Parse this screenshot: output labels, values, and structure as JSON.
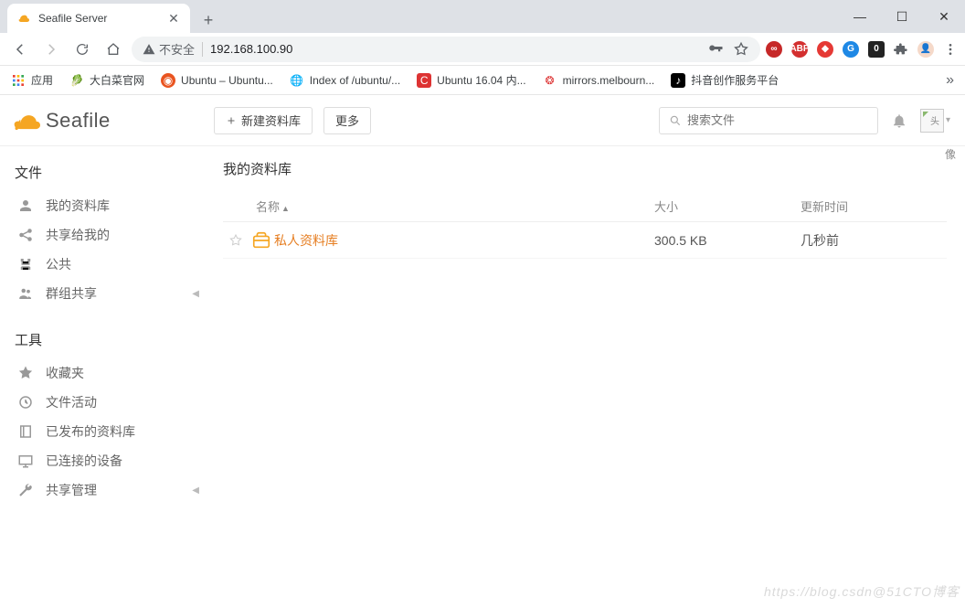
{
  "browser": {
    "tab_title": "Seafile Server",
    "url_warning": "不安全",
    "url": "192.168.100.90",
    "window_controls": {
      "min": "—",
      "max": "☐",
      "close": "✕"
    }
  },
  "bookmarks": {
    "apps_label": "应用",
    "items": [
      {
        "label": "大白菜官网"
      },
      {
        "label": "Ubuntu – Ubuntu..."
      },
      {
        "label": "Index of /ubuntu/..."
      },
      {
        "label": "Ubuntu 16.04 内..."
      },
      {
        "label": "mirrors.melbourn..."
      },
      {
        "label": "抖音创作服务平台"
      }
    ]
  },
  "app": {
    "logo_text": "Seafile",
    "new_library_label": "新建资料库",
    "more_label": "更多",
    "search_placeholder": "搜索文件",
    "avatar_alt": "头",
    "avatar_caption": "像"
  },
  "sidebar": {
    "files_heading": "文件",
    "tools_heading": "工具",
    "files": [
      {
        "label": "我的资料库"
      },
      {
        "label": "共享给我的"
      },
      {
        "label": "公共"
      },
      {
        "label": "群组共享",
        "expandable": true
      }
    ],
    "tools": [
      {
        "label": "收藏夹"
      },
      {
        "label": "文件活动"
      },
      {
        "label": "已发布的资料库"
      },
      {
        "label": "已连接的设备"
      },
      {
        "label": "共享管理",
        "expandable": true
      }
    ]
  },
  "content": {
    "title": "我的资料库",
    "columns": {
      "name": "名称",
      "size": "大小",
      "time": "更新时间"
    },
    "rows": [
      {
        "name": "私人资料库",
        "size": "300.5 KB",
        "time": "几秒前"
      }
    ]
  },
  "watermark": "https://blog.csdn@51CTO博客"
}
